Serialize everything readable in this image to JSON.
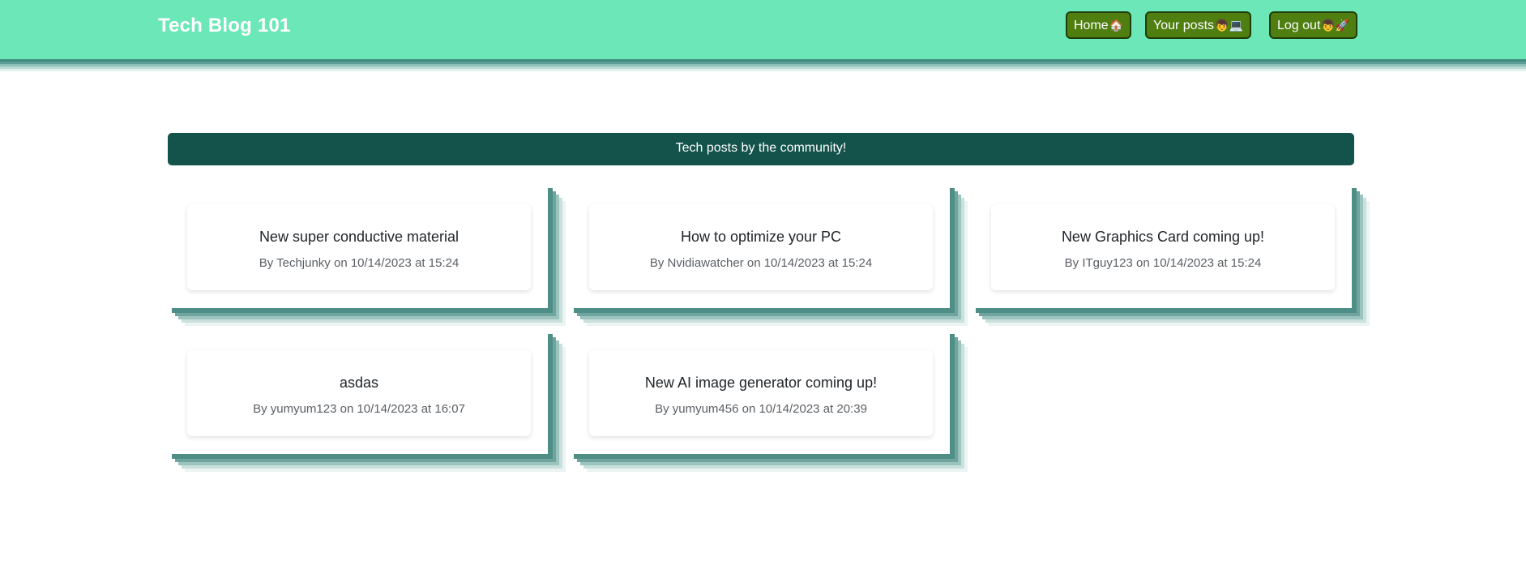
{
  "header": {
    "brand": "Tech Blog 101",
    "nav": [
      {
        "label": "Home",
        "emoji": "🏠"
      },
      {
        "label": "Your posts",
        "emoji": "👦💻"
      },
      {
        "label": "Log out",
        "emoji": "👦🚀"
      }
    ]
  },
  "main": {
    "banner": "Tech posts by the community!",
    "posts": [
      {
        "title": "New super conductive material",
        "meta": "By Techjunky on 10/14/2023 at 15:24"
      },
      {
        "title": "How to optimize your PC",
        "meta": "By Nvidiawatcher on 10/14/2023 at 15:24"
      },
      {
        "title": "New Graphics Card coming up!",
        "meta": "By ITguy123 on 10/14/2023 at 15:24"
      },
      {
        "title": "asdas",
        "meta": "By yumyum123 on 10/14/2023 at 16:07"
      },
      {
        "title": "New AI image generator coming up!",
        "meta": "By yumyum456 on 10/14/2023 at 20:39"
      }
    ]
  },
  "colors": {
    "header_bg": "#6ce8b8",
    "nav_button_bg": "#4e7f10",
    "banner_bg": "#14524c",
    "card_shadow": "#4f8e86"
  }
}
